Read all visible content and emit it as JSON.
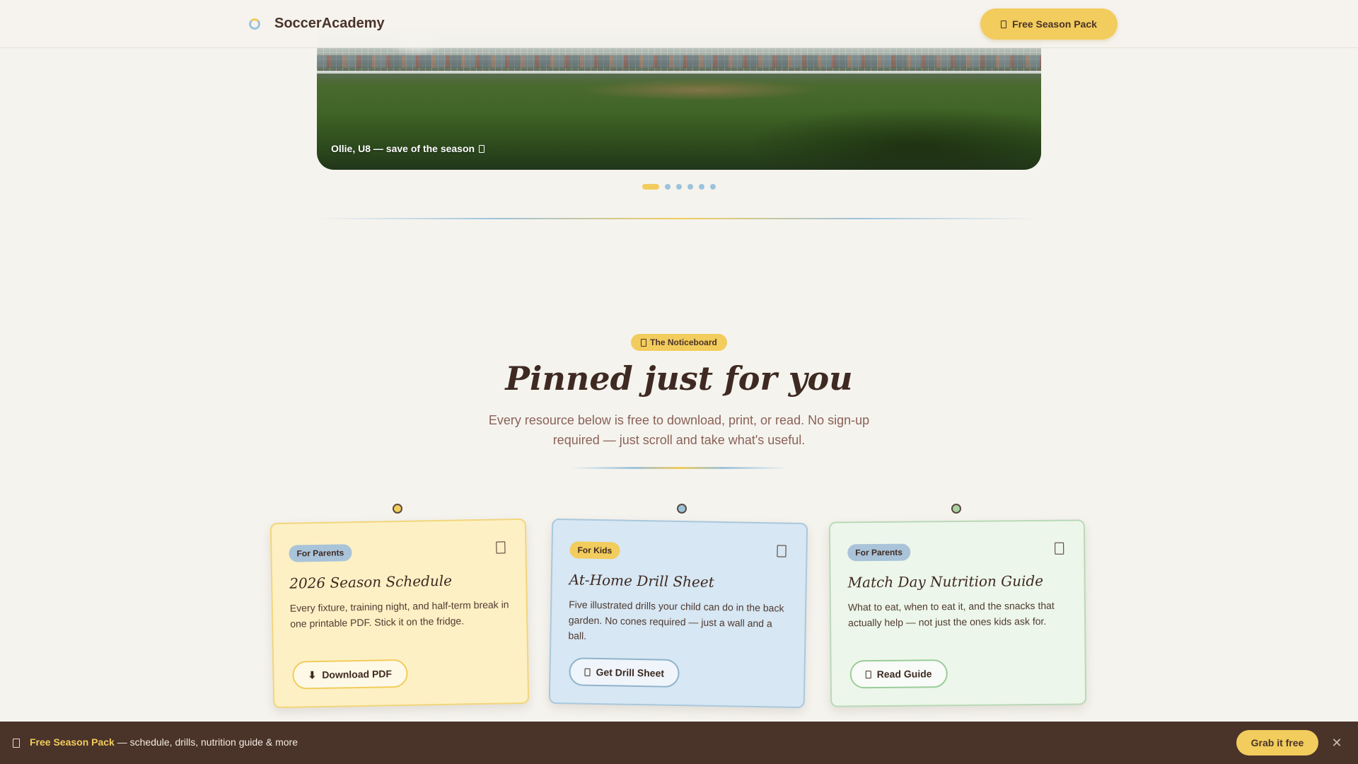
{
  "header": {
    "brand": "SoccerAcademy",
    "cta_label": "Free Season Pack"
  },
  "hero": {
    "caption": "Ollie, U8 — save of the season",
    "slides_total": 6,
    "active_slide": 1
  },
  "noticeboard": {
    "pill_label": "The Noticeboard",
    "title": "Pinned just for you",
    "subtitle": "Every resource below is free to download, print, or read. No sign-up required — just scroll and take what's useful."
  },
  "cards": [
    {
      "tag": "For Parents",
      "title": "2026 Season Schedule",
      "description": "Every fixture, training night, and half-term break in one printable PDF. Stick it on the fridge.",
      "button_label": "Download PDF",
      "button_icon": "download-icon",
      "color": "#fdf0c4"
    },
    {
      "tag": "For Kids",
      "title": "At-Home Drill Sheet",
      "description": "Five illustrated drills your child can do in the back garden. No cones required — just a wall and a ball.",
      "button_label": "Get Drill Sheet",
      "button_icon": "document-icon",
      "color": "#d7e7f3"
    },
    {
      "tag": "For Parents",
      "title": "Match Day Nutrition Guide",
      "description": "What to eat, when to eat it, and the snacks that actually help — not just the ones kids ask for.",
      "button_label": "Read Guide",
      "button_icon": "book-icon",
      "color": "#edf6ea"
    }
  ],
  "bottom_bar": {
    "highlight": "Free Season Pack",
    "text": " — schedule, drills, nutrition guide & more",
    "button_label": "Grab it free",
    "close_icon": "close-icon"
  },
  "colors": {
    "accent_yellow": "#f2cc5c",
    "accent_blue": "#9cc3dc",
    "dark_brown": "#4a3329",
    "background": "#f5f3ee"
  }
}
